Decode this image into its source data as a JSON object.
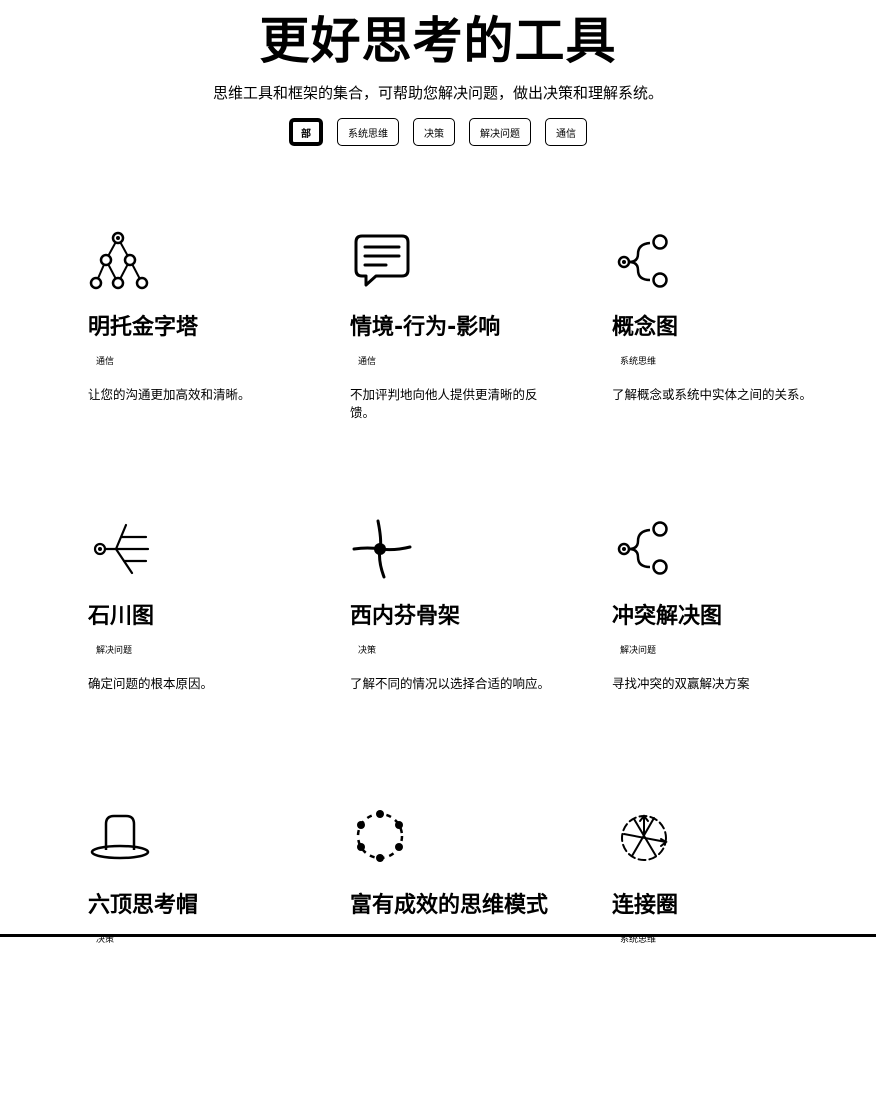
{
  "header": {
    "title": "更好思考的工具",
    "subtitle": "思维工具和框架的集合，可帮助您解决问题，做出决策和理解系统。"
  },
  "filters": [
    {
      "label": "部",
      "active": true
    },
    {
      "label": "系统思维",
      "active": false
    },
    {
      "label": "决策",
      "active": false
    },
    {
      "label": "解决问题",
      "active": false
    },
    {
      "label": "通信",
      "active": false
    }
  ],
  "cards": [
    {
      "title": "明托金字塔",
      "tag": "通信",
      "description": "让您的沟通更加高效和清晰。",
      "icon": "pyramid-tree-icon"
    },
    {
      "title": "情境-行为-影响",
      "tag": "通信",
      "description": "不加评判地向他人提供更清晰的反馈。",
      "icon": "speech-bubble-icon"
    },
    {
      "title": "概念图",
      "tag": "系统思维",
      "description": "了解概念或系统中实体之间的关系。",
      "icon": "branch-nodes-icon"
    },
    {
      "title": "石川图",
      "tag": "解决问题",
      "description": "确定问题的根本原因。",
      "icon": "fishbone-icon"
    },
    {
      "title": "西内芬骨架",
      "tag": "决策",
      "description": "了解不同的情况以选择合适的响应。",
      "icon": "cynefin-cross-icon"
    },
    {
      "title": "冲突解决图",
      "tag": "解决问题",
      "description": "寻找冲突的双赢解决方案",
      "icon": "branch-nodes-icon"
    },
    {
      "title": "六顶思考帽",
      "tag": "决策",
      "description": "",
      "icon": "top-hat-icon"
    },
    {
      "title": "富有成效的思维模式",
      "tag": "",
      "description": "",
      "icon": "node-circle-icon"
    },
    {
      "title": "连接圈",
      "tag": "系统思维",
      "description": "",
      "icon": "connection-circle-icon"
    }
  ]
}
